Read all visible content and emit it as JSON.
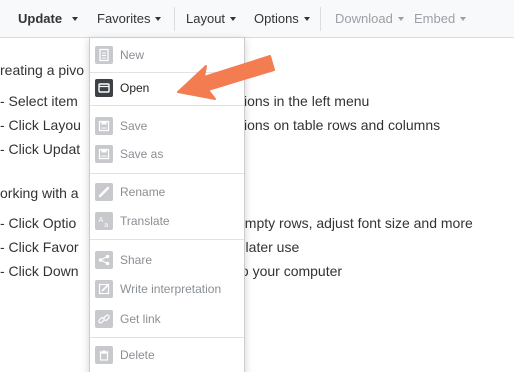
{
  "toolbar": {
    "update_label": "Update",
    "favorites_label": "Favorites",
    "layout_label": "Layout",
    "options_label": "Options",
    "download_label": "Download",
    "embed_label": "Embed"
  },
  "content": {
    "heading1": "reating a pivo",
    "lines1": [
      {
        "left": "- Select item",
        "right": "sions in the left menu"
      },
      {
        "left": "- Click Layou",
        "right": "sions on table rows and columns"
      },
      {
        "left": "- Click Updat",
        "right": ""
      }
    ],
    "heading2": "orking with a",
    "lines2": [
      {
        "left": "- Click Optio",
        "right": "empty rows, adjust font size and more"
      },
      {
        "left": "- Click Favor",
        "right": "r later use"
      },
      {
        "left": "- Click Down",
        "right": "to your computer"
      }
    ]
  },
  "menu": {
    "items": [
      {
        "label": "New",
        "icon": "new-file-icon",
        "active": false
      },
      {
        "label": "Open",
        "icon": "folder-open-icon",
        "active": true
      },
      {
        "label": "Save",
        "icon": "save-icon",
        "active": false
      },
      {
        "label": "Save as",
        "icon": "save-as-icon",
        "active": false
      },
      {
        "label": "Rename",
        "icon": "pencil-icon",
        "active": false
      },
      {
        "label": "Translate",
        "icon": "translate-icon",
        "active": false
      },
      {
        "label": "Share",
        "icon": "share-icon",
        "active": false
      },
      {
        "label": "Write interpretation",
        "icon": "edit-icon",
        "active": false
      },
      {
        "label": "Get link",
        "icon": "link-icon",
        "active": false
      },
      {
        "label": "Delete",
        "icon": "trash-icon",
        "active": false
      }
    ]
  },
  "colors": {
    "arrow": "#f47c51",
    "active_icon": "#3d4045",
    "disabled_icon": "#c7c9cc",
    "disabled_text": "#8a8f94"
  }
}
